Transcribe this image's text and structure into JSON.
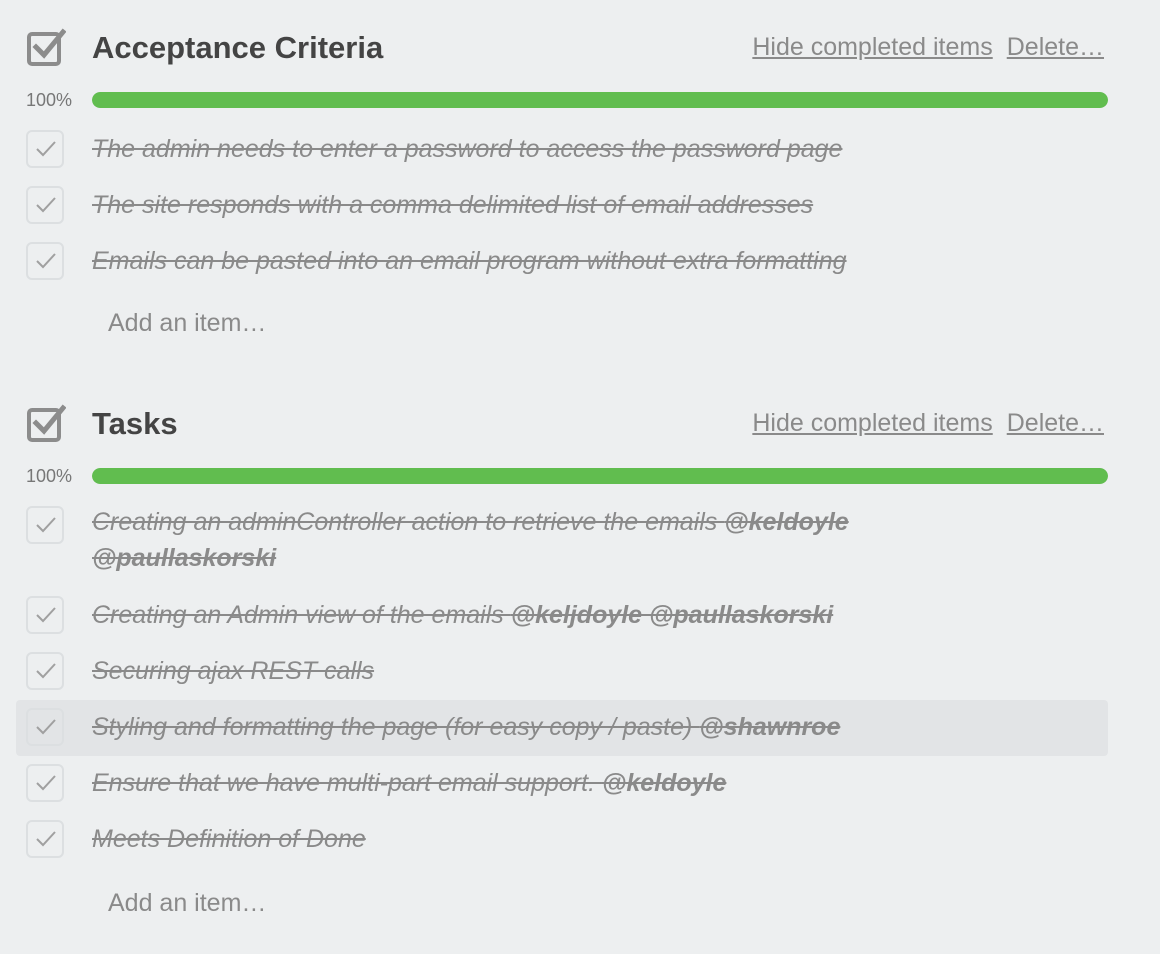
{
  "checklists": [
    {
      "title": "Acceptance Criteria",
      "hide_completed_label": "Hide completed items",
      "delete_label": "Delete…",
      "progress_text": "100%",
      "progress": 1.0,
      "items": [
        {
          "text": "The admin needs to enter a password to access the password page",
          "mentions": "",
          "checked": true
        },
        {
          "text": "The site responds with a comma delimited list of email addresses",
          "mentions": "",
          "checked": true
        },
        {
          "text": "Emails can be pasted into an email program without extra formatting",
          "mentions": "",
          "checked": true
        }
      ],
      "add_item_label": "Add an item…"
    },
    {
      "title": "Tasks",
      "hide_completed_label": "Hide completed items",
      "delete_label": "Delete…",
      "progress_text": "100%",
      "progress": 1.0,
      "items": [
        {
          "text": "Creating an adminController action to retrieve the emails ",
          "mentions": "@keldoyle @paullaskorski",
          "checked": true
        },
        {
          "text": "Creating an Admin view of the emails ",
          "mentions": "@keljdoyle @paullaskorski",
          "checked": true
        },
        {
          "text": "Securing ajax REST calls",
          "mentions": "",
          "checked": true
        },
        {
          "text": "Styling and formatting the page (for easy copy / paste) ",
          "mentions": "@shawnroe",
          "checked": true
        },
        {
          "text": "Ensure that we have multi-part email support. ",
          "mentions": "@keldoyle",
          "checked": true
        },
        {
          "text": "Meets Definition of Done",
          "mentions": "",
          "checked": true
        }
      ],
      "add_item_label": "Add an item…"
    }
  ],
  "colors": {
    "progress_fill": "#61bd4f",
    "background": "#edeff0",
    "hover_row": "#e2e4e6"
  }
}
